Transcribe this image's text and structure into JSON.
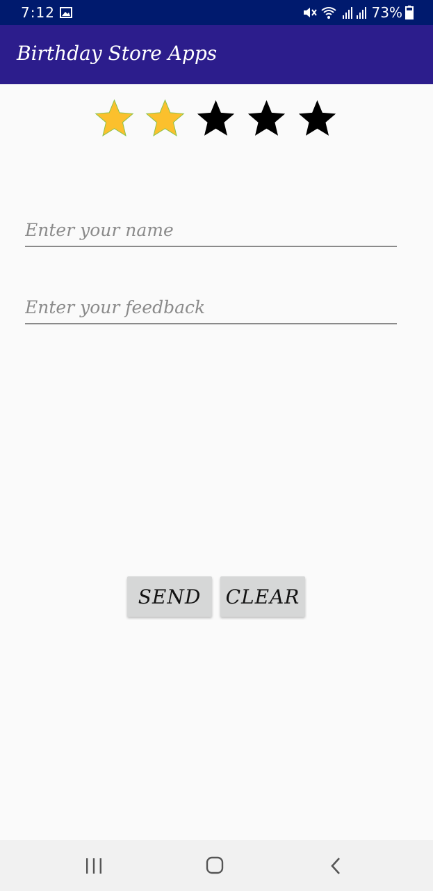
{
  "status_bar": {
    "time": "7:12",
    "battery_text": "73%",
    "icons": [
      "image-icon",
      "mute-icon",
      "wifi-icon",
      "signal-icon",
      "battery-icon"
    ]
  },
  "app_bar": {
    "title": "Birthday Store Apps",
    "color": "#2c1d8c"
  },
  "rating": {
    "value": 2,
    "max": 5,
    "filled_color": "#fbc02d",
    "empty_color": "#000000"
  },
  "form": {
    "name_placeholder": "Enter your name",
    "name_value": "",
    "feedback_placeholder": "Enter your feedback",
    "feedback_value": ""
  },
  "buttons": {
    "send_label": "SEND",
    "clear_label": "CLEAR"
  },
  "nav_bar": {
    "icons": [
      "recent-apps-icon",
      "home-icon",
      "back-icon"
    ]
  }
}
